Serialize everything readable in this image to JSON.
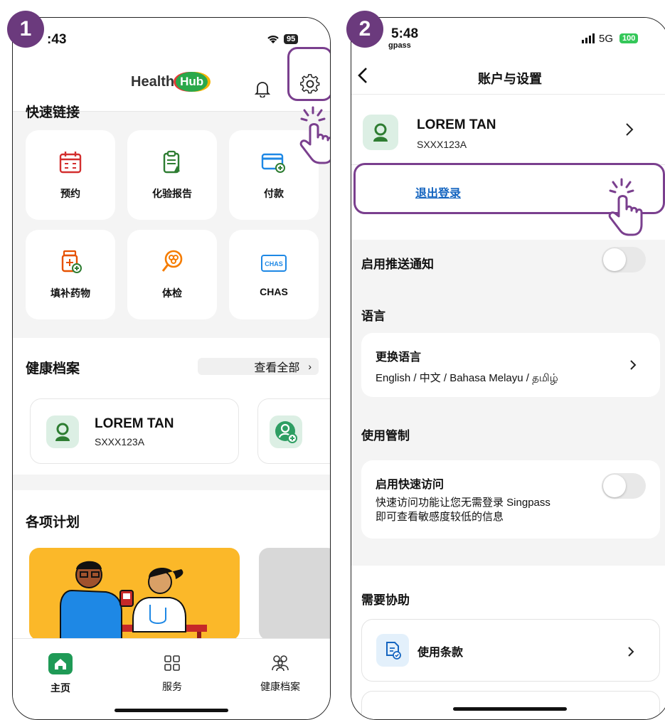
{
  "badges": {
    "step1": "1",
    "step2": "2"
  },
  "phone1": {
    "status": {
      "time": ":43",
      "battery": "95"
    },
    "header": {
      "logo_text": "Health",
      "logo_hub": "Hub"
    },
    "quick_links": {
      "title": "快速链接",
      "items": [
        {
          "label": "预约",
          "icon": "calendar-icon"
        },
        {
          "label": "化验报告",
          "icon": "lab-report-icon"
        },
        {
          "label": "付款",
          "icon": "payment-card-icon"
        },
        {
          "label": "填补药物",
          "icon": "medicine-bottle-icon"
        },
        {
          "label": "体检",
          "icon": "screening-icon"
        },
        {
          "label": "CHAS",
          "icon": "chas-icon"
        }
      ]
    },
    "health_records": {
      "title": "健康档案",
      "view_all": "查看全部",
      "name": "LOREM TAN",
      "id": "SXXX123A"
    },
    "programs": {
      "title": "各项计划"
    },
    "tabs": [
      {
        "label": "主页",
        "icon": "home-icon"
      },
      {
        "label": "服务",
        "icon": "services-grid-icon"
      },
      {
        "label": "健康档案",
        "icon": "family-icon"
      }
    ]
  },
  "phone2": {
    "status": {
      "time": "5:48",
      "carrier": "gpass",
      "network": "5G",
      "battery": "100"
    },
    "nav": {
      "title": "账户与设置"
    },
    "profile": {
      "name": "LOREM TAN",
      "id": "SXXX123A"
    },
    "logout": "退出登录",
    "push": {
      "label": "启用推送通知"
    },
    "language": {
      "section": "语言",
      "title": "更换语言",
      "options": "English / 中文 / Bahasa Melayu / தமிழ்"
    },
    "access": {
      "section": "使用管制",
      "title": "启用快速访问",
      "desc1": "快速访问功能让您无需登录 Singpass",
      "desc2": "即可查看敏感度较低的信息"
    },
    "help": {
      "section": "需要协助",
      "terms": "使用条款"
    }
  },
  "colors": {
    "accent": "#7a3f8e",
    "badge": "#6b3a7d",
    "brand_green": "#2aa84a",
    "link": "#1565c0"
  }
}
